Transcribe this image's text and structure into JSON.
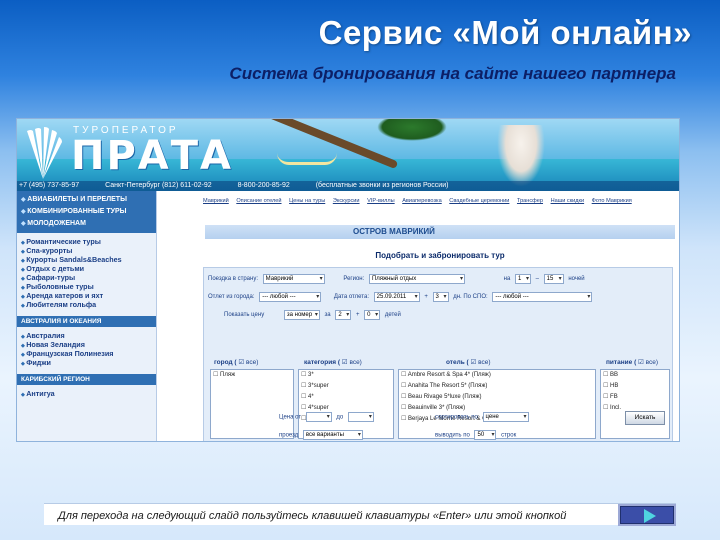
{
  "slide": {
    "title": "Сервис «Мой онлайн»",
    "subtitle": "Система бронирования на сайте нашего партнера",
    "footer": "Для перехода на следующий слайд пользуйтесь клавишей клавиатуры «Enter» или этой кнопкой"
  },
  "site": {
    "logo_small": "ТУРОПЕРАТОР",
    "logo_big": "ПРАТА",
    "phones": [
      "+7 (495) 737-85-97",
      "Санкт-Петербург (812) 611-02-92",
      "8-800-200-85-92"
    ],
    "phones_note": "(бесплатные звонки из регионов России)",
    "topnav": [
      "Маврикий",
      "Описание отелей",
      "Цены на туры",
      "Экскурсии",
      "VIP-виллы",
      "Авиаперевозка",
      "Свадебные церемонии",
      "Трансфер",
      "Наши скидки",
      "Фото Маврикия"
    ]
  },
  "menu": {
    "primary": [
      "АВИАБИЛЕТЫ И ПЕРЕЛЕТЫ",
      "КОМБИНИРОВАННЫЕ ТУРЫ",
      "МОЛОДОЖЕНАМ"
    ],
    "secondary": [
      "Романтические туры",
      "Спа-курорты",
      "Курорты Sandals&Beaches",
      "Отдых с детьми",
      "Сафари-туры",
      "Рыболовные туры",
      "Аренда катеров и яхт",
      "Любителям гольфа"
    ],
    "region1": "АВСТРАЛИЯ И ОКЕАНИЯ",
    "region1_items": [
      "Австралия",
      "Новая Зеландия",
      "Французская Полинезия",
      "Фиджи"
    ],
    "region2": "КАРИБСКИЙ РЕГИОН",
    "region2_items": [
      "Антигуа"
    ]
  },
  "booking": {
    "island": "ОСТРОВ МАВРИКИЙ",
    "heading": "Подобрать и забронировать тур",
    "row1": {
      "label": "Поездка в страну:",
      "country": "Маврикий",
      "region_label": "Регион:",
      "region": "Пляжный отдых",
      "on_label": "на",
      "nights_from": "1",
      "dash": "–",
      "nights_to": "15",
      "nights_label": "ночей"
    },
    "row2": {
      "label": "Отлет из города:",
      "city": "--- любой ---",
      "date_label": "Дата отлета:",
      "date": "25.09.2011",
      "plus": "+",
      "days": "3",
      "spo_label": "дн. По СПО:",
      "spo": "--- любой ---"
    },
    "row3": {
      "label": "Показать цену",
      "price_type": "за номер",
      "in_label": "за",
      "adults": "2",
      "plus": "+",
      "children": "0",
      "children_label": "детей"
    },
    "columns": {
      "city": "город (",
      "category": "категория (",
      "hotel": "отель (",
      "meal": "питание ("
    },
    "cities": [
      "Пляж"
    ],
    "categories": [
      "3*",
      "3*super",
      "4*",
      "4*super",
      "5*"
    ],
    "hotels": [
      "Ambre Resort & Spa 4* (Пляж)",
      "Anahita The Resort 5* (Пляж)",
      "Beau Rivage 5*luxe (Пляж)",
      "Beauinville 3* (Пляж)",
      "Berjaya Le Morne Resort & Casino"
    ],
    "meals": [
      "BB",
      "HB",
      "FB",
      "Incl."
    ],
    "price_label": "Цена",
    "from_label": "от",
    "to_label": "до",
    "sort_label": "сортировать по",
    "sort_value": "цене",
    "transfer_label": "проезд",
    "transfer_value": "все варианты",
    "output_label": "выводить по",
    "output_value": "50",
    "rows_label": "строк",
    "search_button": "Искать"
  }
}
